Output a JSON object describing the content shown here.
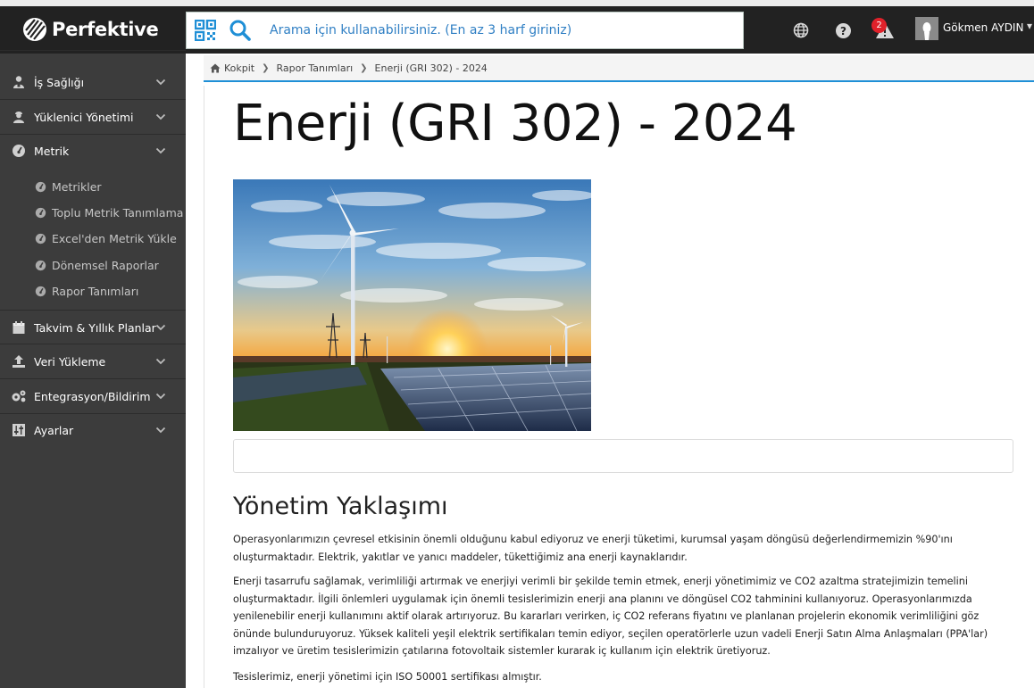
{
  "app": {
    "brand": "Perfektive"
  },
  "search": {
    "placeholder": "Arama için kullanabilirsiniz. (En az 3 harf giriniz)"
  },
  "topbar": {
    "alert_count": "2",
    "user_name": "Gökmen AYDIN",
    "icons": [
      "globe-icon",
      "help-icon",
      "alert-icon",
      "user-avatar",
      "chevron-down-icon"
    ]
  },
  "sidebar": {
    "items": [
      {
        "label": "İş Sağlığı",
        "icon": "health-worker-icon"
      },
      {
        "label": "Yüklenici Yönetimi",
        "icon": "contractor-icon"
      },
      {
        "label": "Metrik",
        "icon": "gauge-icon"
      },
      {
        "label": "Takvim & Yıllık Planlar",
        "icon": "calendar-icon"
      },
      {
        "label": "Veri Yükleme",
        "icon": "upload-icon"
      },
      {
        "label": "Entegrasyon/Bildirim",
        "icon": "cogs-icon"
      },
      {
        "label": "Ayarlar",
        "icon": "sliders-icon"
      }
    ],
    "metrik_sub": [
      {
        "label": "Metrikler"
      },
      {
        "label": "Toplu Metrik Tanımlama"
      },
      {
        "label": "Excel'den Metrik Yükle"
      },
      {
        "label": "Dönemsel Raporlar"
      },
      {
        "label": "Rapor Tanımları"
      }
    ]
  },
  "breadcrumb": {
    "items": [
      "Kokpit",
      "Rapor Tanımları",
      "Enerji (GRI 302) - 2024"
    ]
  },
  "page": {
    "title": "Enerji (GRI 302) - 2024",
    "section_title": "Yönetim Yaklaşımı",
    "paragraphs": [
      "Operasyonlarımızın çevresel etkisinin önemli olduğunu kabul ediyoruz ve enerji tüketimi, kurumsal yaşam döngüsü değerlendirmemizin %90'ını oluşturmaktadır. Elektrik, yakıtlar ve yanıcı maddeler, tükettiğimiz ana enerji kaynaklarıdır.",
      "Enerji tasarrufu sağlamak, verimliliği artırmak ve enerjiyi verimli bir şekilde temin etmek, enerji yönetimimiz ve CO2 azaltma stratejimizin temelini oluşturmaktadır. İlgili önlemleri uygulamak için önemli tesislerimizin enerji ana planını ve döngüsel CO2 tahminini kullanıyoruz. Operasyonlarımızda yenilenebilir enerji kullanımını aktif olarak artırıyoruz. Bu kararları verirken, iç CO2 referans fiyatını ve planlanan projelerin ekonomik verimliliğini göz önünde bulunduruyoruz. Yüksek kaliteli yeşil elektrik sertifikaları temin ediyor, seçilen operatörlerle uzun vadeli Enerji Satın Alma Anlaşmaları (PPA'lar) imzalıyor ve üretim tesislerimizin çatılarına fotovoltaik sistemler kurarak iç kullanım için elektrik üretiyoruz.",
      "Tesislerimiz, enerji yönetimi için ISO 50001 sertifikası almıştır."
    ]
  },
  "colors": {
    "topbar": "#222222",
    "sidebar": "#3c3c3c",
    "accent": "#1f8fd6",
    "search_text": "#2f7fc4",
    "badge": "#e0212a"
  }
}
